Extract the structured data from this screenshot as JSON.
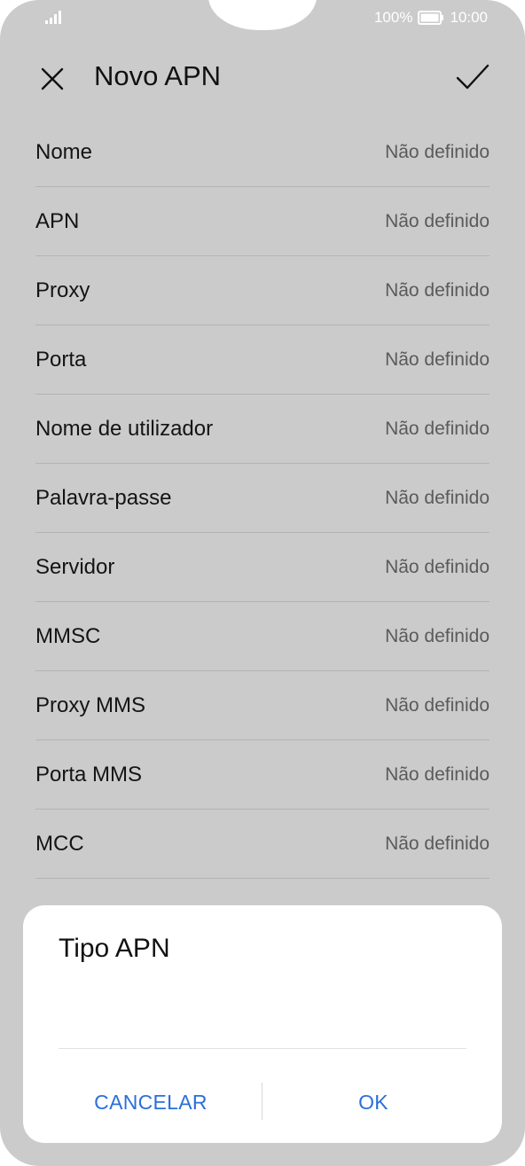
{
  "status_bar": {
    "battery_text": "100%",
    "time": "10:00",
    "icons": [
      "signal-icon",
      "battery-icon"
    ]
  },
  "app_bar": {
    "title": "Novo APN",
    "close_icon": "close-icon",
    "confirm_icon": "check-icon"
  },
  "settings": [
    {
      "label": "Nome",
      "value": "Não definido"
    },
    {
      "label": "APN",
      "value": "Não definido"
    },
    {
      "label": "Proxy",
      "value": "Não definido"
    },
    {
      "label": "Porta",
      "value": "Não definido"
    },
    {
      "label": "Nome de utilizador",
      "value": "Não definido"
    },
    {
      "label": "Palavra-passe",
      "value": "Não definido"
    },
    {
      "label": "Servidor",
      "value": "Não definido"
    },
    {
      "label": "MMSC",
      "value": "Não definido"
    },
    {
      "label": "Proxy MMS",
      "value": "Não definido"
    },
    {
      "label": "Porta MMS",
      "value": "Não definido"
    },
    {
      "label": "MCC",
      "value": "Não definido"
    }
  ],
  "dialog": {
    "title": "Tipo APN",
    "cancel_label": "CANCELAR",
    "ok_label": "OK"
  },
  "colors": {
    "background_dim": "#cbcbcb",
    "accent": "#2b6fdb"
  }
}
